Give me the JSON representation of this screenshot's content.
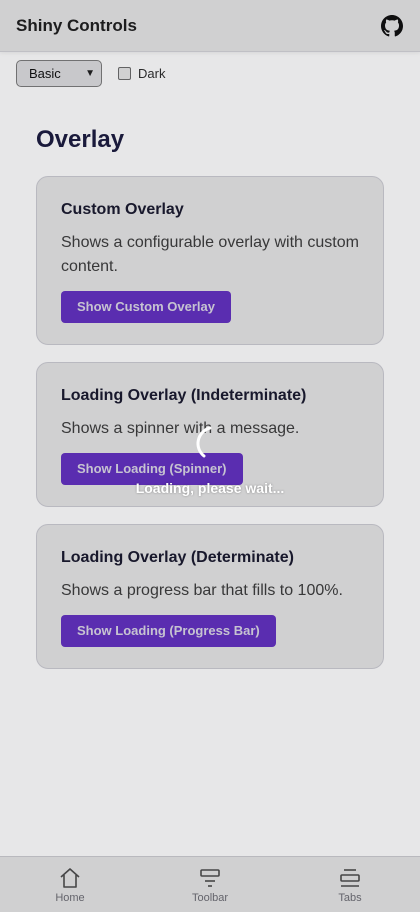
{
  "header": {
    "title": "Shiny Controls",
    "github_icon": "github-icon"
  },
  "controls": {
    "theme_select_value": "Basic",
    "dark_label": "Dark",
    "dark_checked": false
  },
  "section": {
    "title": "Overlay"
  },
  "cards": [
    {
      "title": "Custom Overlay",
      "description": "Shows a configurable overlay with custom content.",
      "button_label": "Show Custom Overlay"
    },
    {
      "title": "Loading Overlay (Indeterminate)",
      "description": "Shows a spinner with a message.",
      "button_label": "Show Loading (Spinner)"
    },
    {
      "title": "Loading Overlay (Determinate)",
      "description": "Shows a progress bar that fills to 100%.",
      "button_label": "Show Loading (Progress Bar)"
    }
  ],
  "overlay": {
    "message": "Loading, please wait...",
    "icon": "spinner-icon"
  },
  "tabbar": {
    "items": [
      {
        "label": "Home",
        "icon": "home-icon"
      },
      {
        "label": "Toolbar",
        "icon": "toolbar-icon"
      },
      {
        "label": "Tabs",
        "icon": "tabs-icon"
      }
    ]
  },
  "colors": {
    "accent": "#6d35d6",
    "title": "#1e1e46",
    "overlay_dim": "#16161f"
  }
}
